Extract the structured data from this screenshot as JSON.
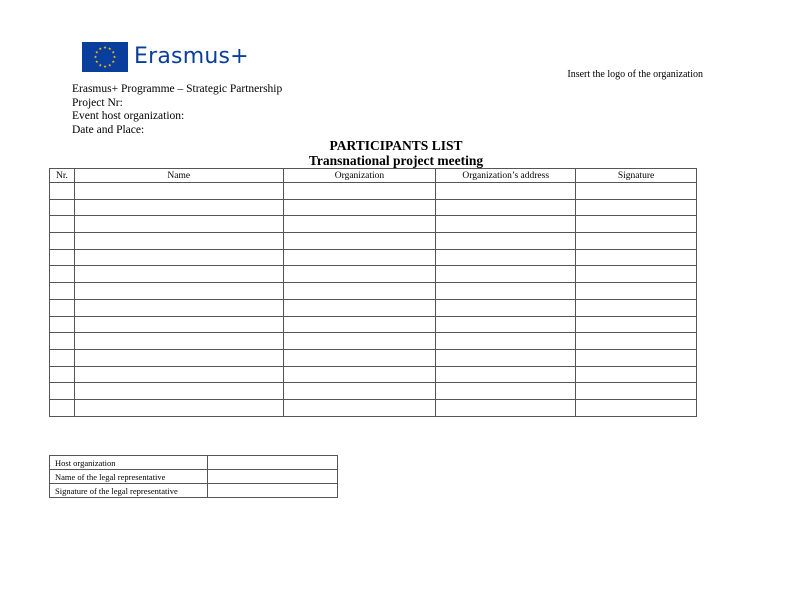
{
  "header": {
    "logo_text": "Erasmus+",
    "logo_note": "Insert the logo of the organization",
    "info_lines": [
      "Erasmus+ Programme – Strategic Partnership",
      "Project Nr:",
      "Event host organization:",
      "Date and Place:"
    ],
    "title": "PARTICIPANTS LIST",
    "subtitle": "Transnational project meeting"
  },
  "participants_table": {
    "headers": [
      "Nr.",
      "Name",
      "Organization",
      "Organization’s address",
      "Signature"
    ],
    "empty_rows": 14
  },
  "host_table": {
    "rows": [
      "Host organization",
      "Name of the legal representative",
      "Signature of the legal representative"
    ]
  },
  "colors": {
    "flag_blue": "#0a3e9c",
    "flag_star": "#ffcc00"
  }
}
